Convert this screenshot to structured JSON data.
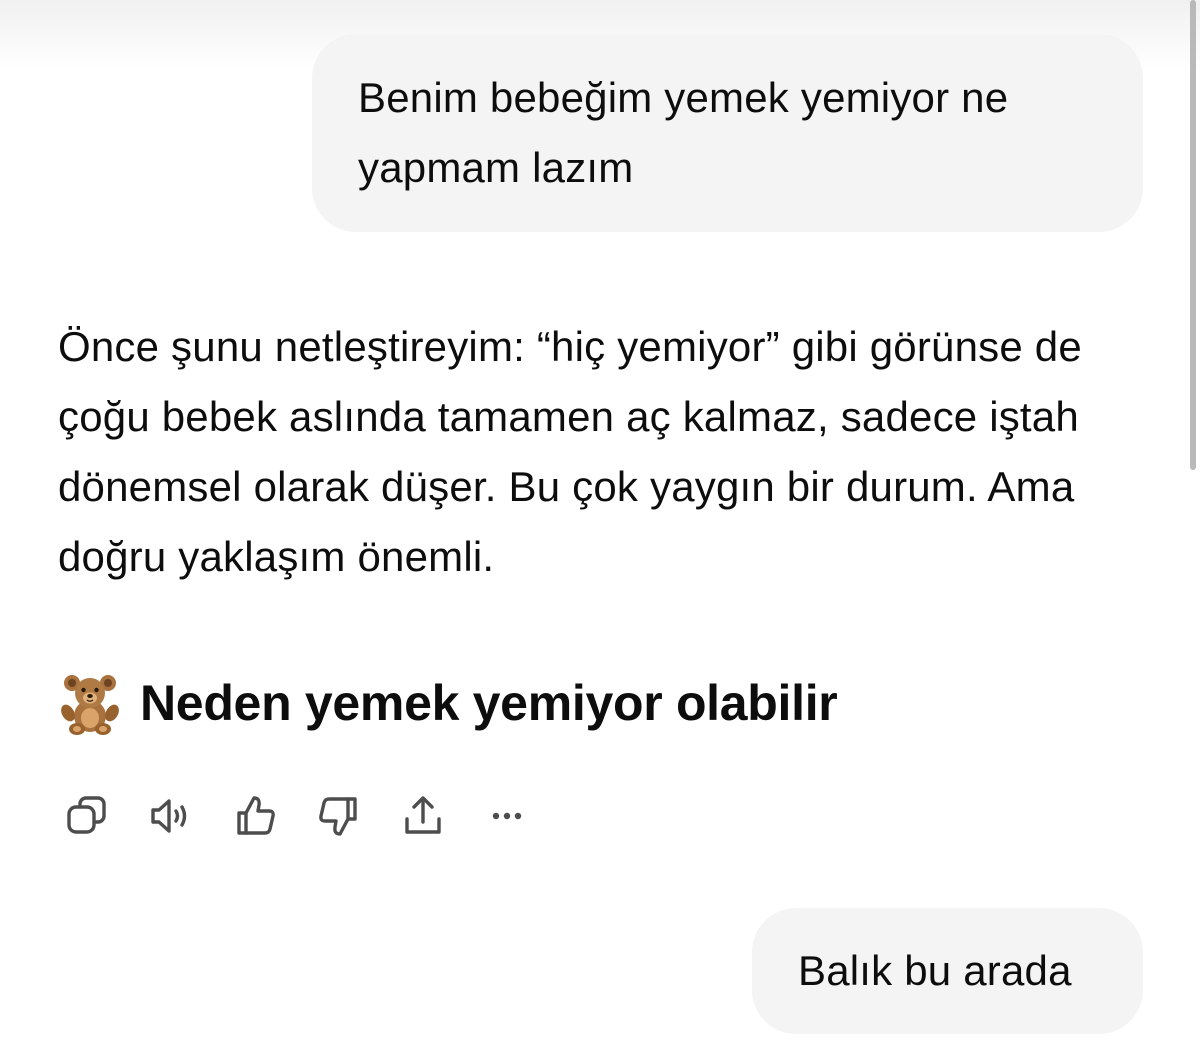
{
  "messages": [
    {
      "role": "user",
      "text": "Benim bebeğim yemek yemiyor ne yapmam lazım"
    },
    {
      "role": "assistant",
      "paragraph": "Önce şunu netleştireyim: “hiç yemiyor” gibi görünse de çoğu bebek aslında tamamen aç kalmaz, sadece iştah dönemsel olarak düşer. Bu çok yaygın bir durum. Ama doğru yaklaşım önemli.",
      "heading": {
        "emoji_icon": "teddy-bear-icon",
        "text": "Neden yemek yemiyor olabilir"
      }
    },
    {
      "role": "user",
      "text": "Balık bu arada"
    }
  ],
  "actions": [
    {
      "icon": "copy-icon"
    },
    {
      "icon": "read-aloud-icon"
    },
    {
      "icon": "thumbs-up-icon"
    },
    {
      "icon": "thumbs-down-icon"
    },
    {
      "icon": "share-icon"
    },
    {
      "icon": "more-icon"
    }
  ],
  "colors": {
    "user_bubble": "#f4f4f4",
    "text": "#0d0d0d",
    "icon": "#5d5d5d"
  }
}
